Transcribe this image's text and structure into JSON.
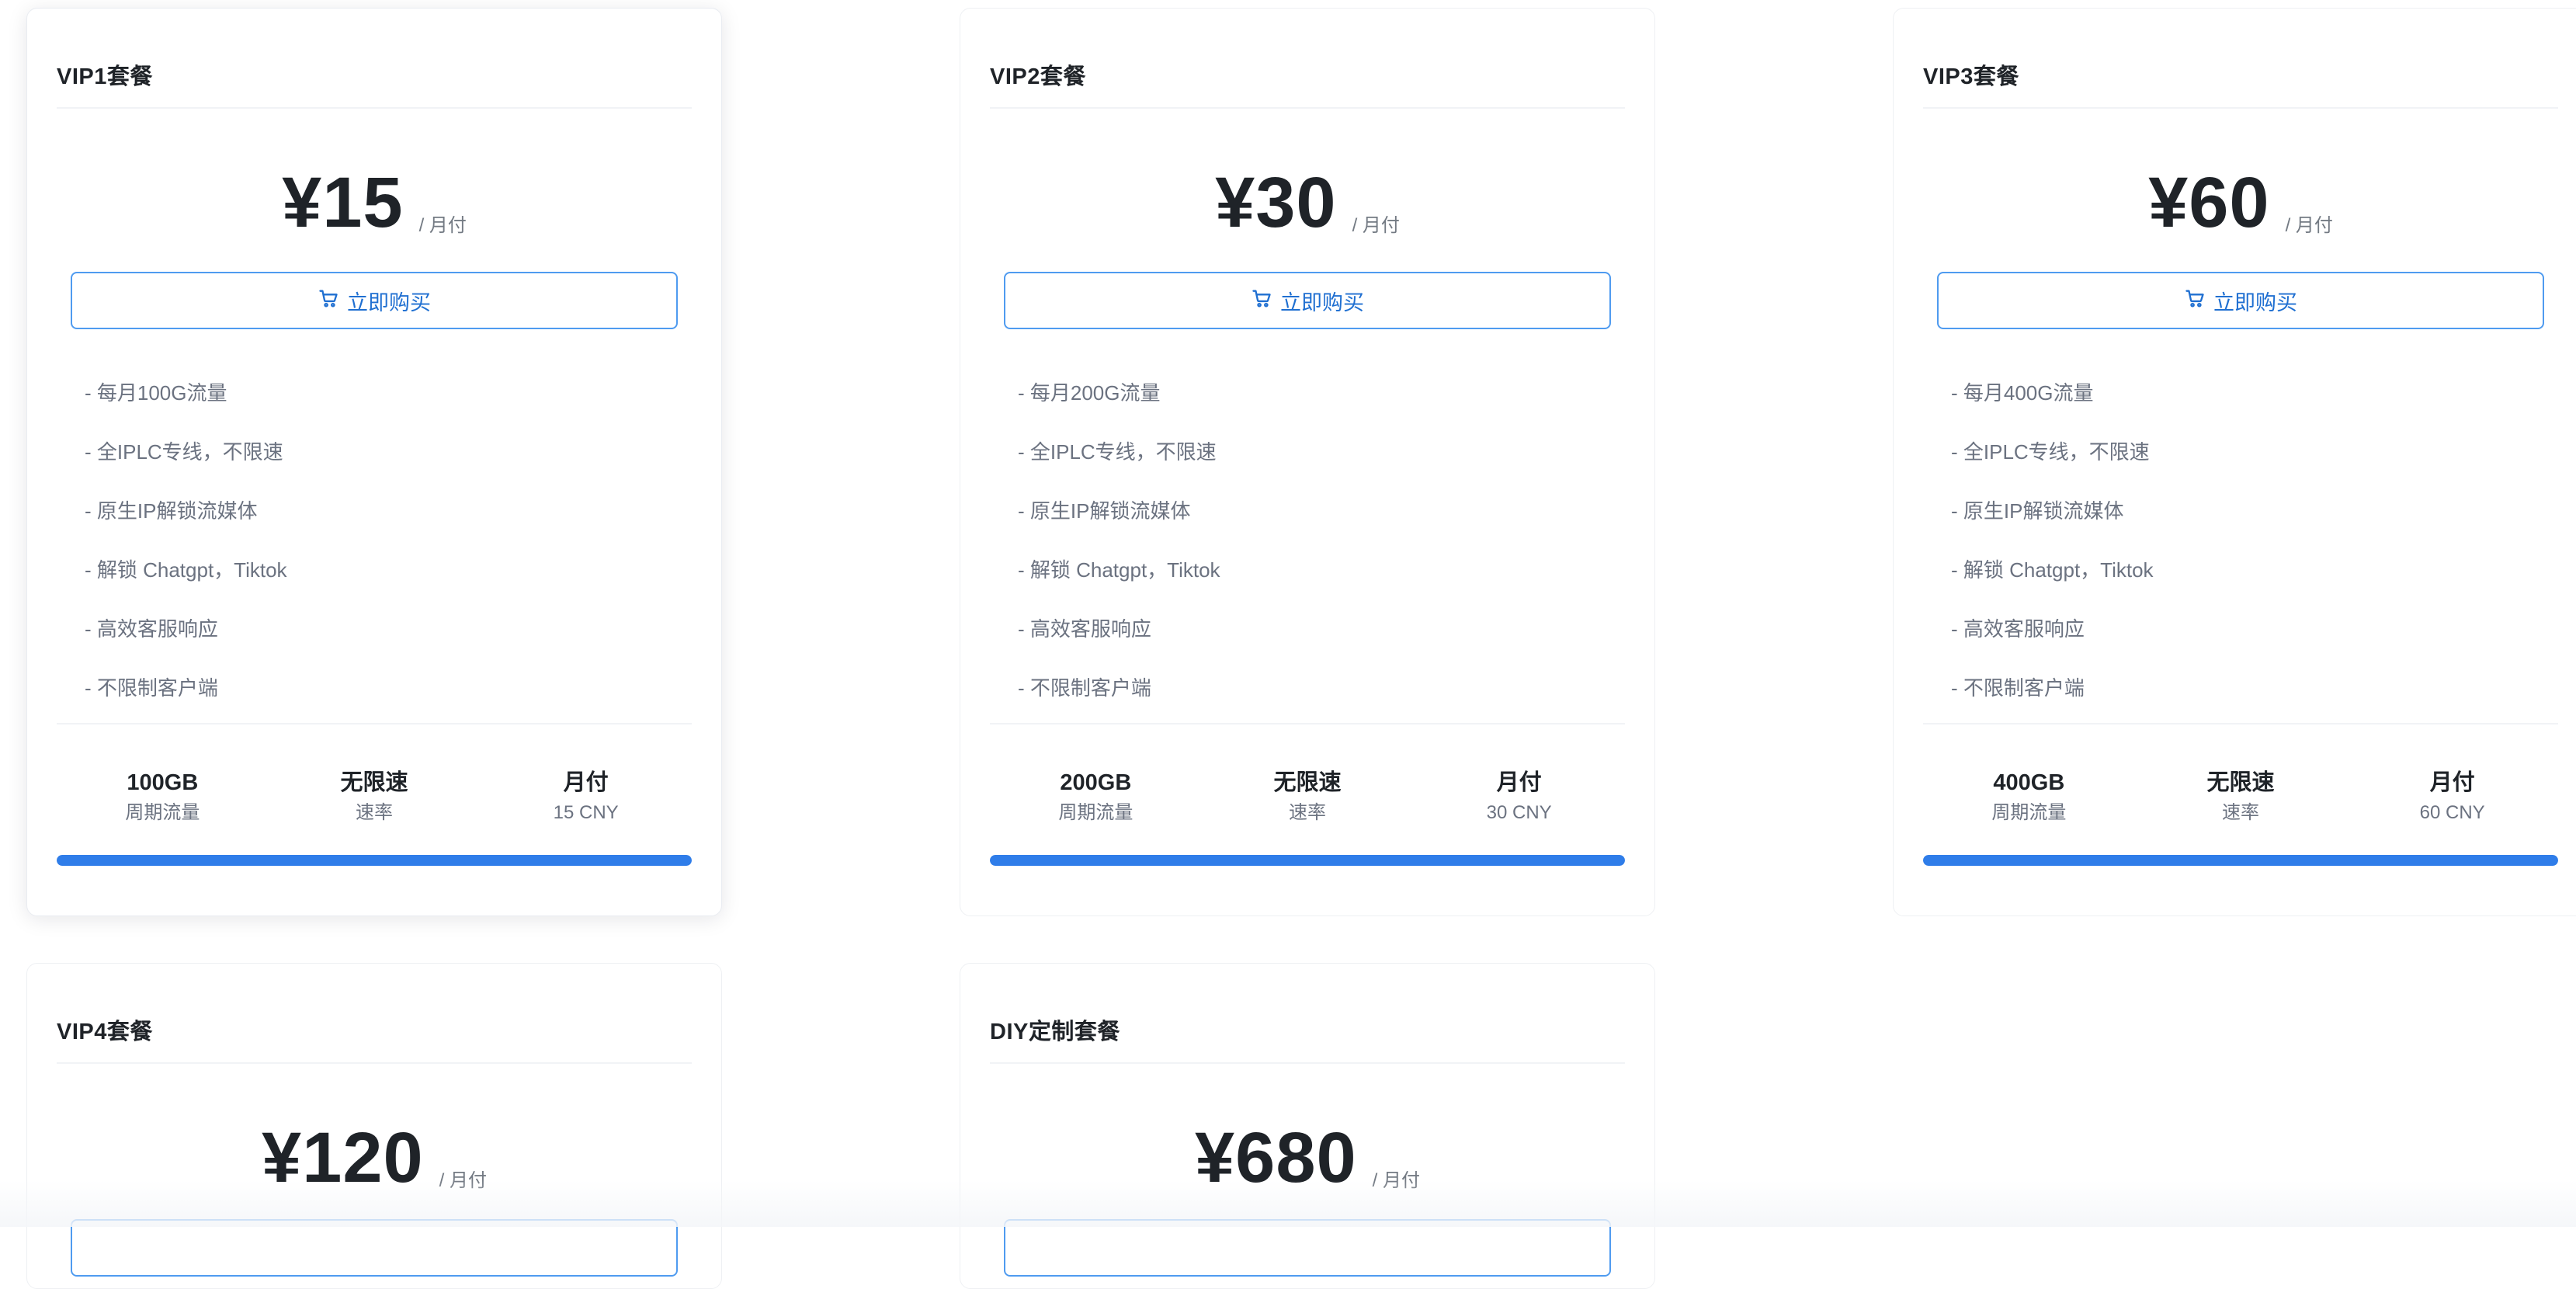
{
  "plans": [
    {
      "title": "VIP1套餐",
      "price": "¥15",
      "period": "/ 月付",
      "buy_label": "立即购买",
      "features": [
        "- 每月100G流量",
        "- 全IPLC专线，不限速",
        "- 原生IP解锁流媒体",
        "- 解锁 Chatgpt，Tiktok",
        "- 高效客服响应",
        "- 不限制客户端"
      ],
      "stats": [
        {
          "value": "100GB",
          "label": "周期流量"
        },
        {
          "value": "无限速",
          "label": "速率"
        },
        {
          "value": "月付",
          "label": "15 CNY"
        }
      ],
      "progress": 1.0
    },
    {
      "title": "VIP2套餐",
      "price": "¥30",
      "period": "/ 月付",
      "buy_label": "立即购买",
      "features": [
        "- 每月200G流量",
        "- 全IPLC专线，不限速",
        "- 原生IP解锁流媒体",
        "- 解锁 Chatgpt，Tiktok",
        "- 高效客服响应",
        "- 不限制客户端"
      ],
      "stats": [
        {
          "value": "200GB",
          "label": "周期流量"
        },
        {
          "value": "无限速",
          "label": "速率"
        },
        {
          "value": "月付",
          "label": "30 CNY"
        }
      ],
      "progress": 1.0
    },
    {
      "title": "VIP3套餐",
      "price": "¥60",
      "period": "/ 月付",
      "buy_label": "立即购买",
      "features": [
        "- 每月400G流量",
        "- 全IPLC专线，不限速",
        "- 原生IP解锁流媒体",
        "- 解锁 Chatgpt，Tiktok",
        "- 高效客服响应",
        "- 不限制客户端"
      ],
      "stats": [
        {
          "value": "400GB",
          "label": "周期流量"
        },
        {
          "value": "无限速",
          "label": "速率"
        },
        {
          "value": "月付",
          "label": "60 CNY"
        }
      ],
      "progress": 1.0
    },
    {
      "title": "VIP4套餐",
      "price": "¥120",
      "period": "/ 月付"
    },
    {
      "title": "DIY定制套餐",
      "price": "¥680",
      "period": "/ 月付"
    }
  ],
  "colors": {
    "accent": "#2f7de9",
    "button_border": "#4f9bf0",
    "button_text": "#1f6fd1",
    "muted_text": "#6b7280"
  },
  "icons": {
    "buy": "cart-icon"
  }
}
